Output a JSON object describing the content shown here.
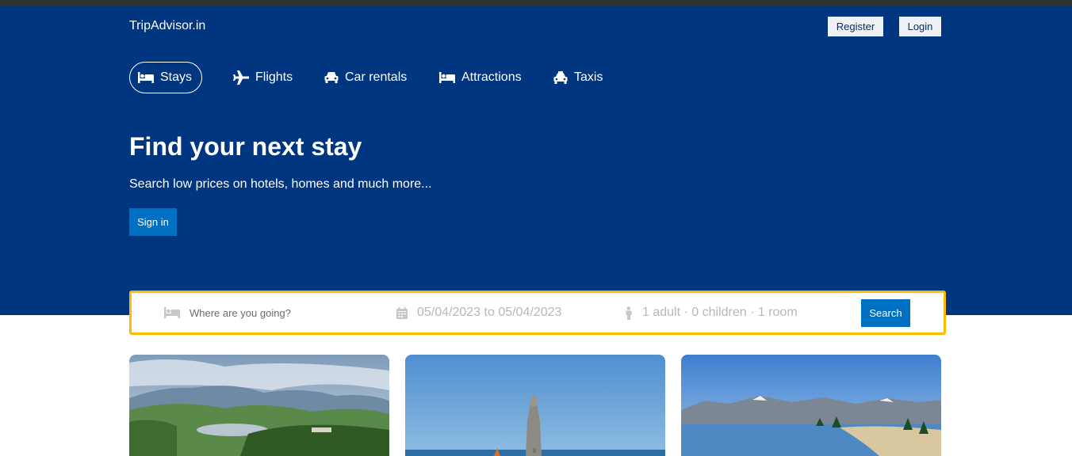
{
  "brand": "TripAdvisor.in",
  "header": {
    "register_label": "Register",
    "login_label": "Login"
  },
  "nav": [
    {
      "label": "Stays",
      "icon": "bed-icon",
      "active": true
    },
    {
      "label": "Flights",
      "icon": "plane-icon",
      "active": false
    },
    {
      "label": "Car rentals",
      "icon": "car-icon",
      "active": false
    },
    {
      "label": "Attractions",
      "icon": "bed-icon",
      "active": false
    },
    {
      "label": "Taxis",
      "icon": "taxi-icon",
      "active": false
    }
  ],
  "hero": {
    "title": "Find your next stay",
    "subtitle": "Search low prices on hotels, homes and much more...",
    "signin_label": "Sign in"
  },
  "search": {
    "destination_placeholder": "Where are you going?",
    "dates": "05/04/2023 to 05/04/2023",
    "guests": "1 adult · 0 children · 1 room",
    "button_label": "Search"
  },
  "colors": {
    "primary": "#003580",
    "accent": "#0071c2",
    "highlight": "#febb02"
  }
}
